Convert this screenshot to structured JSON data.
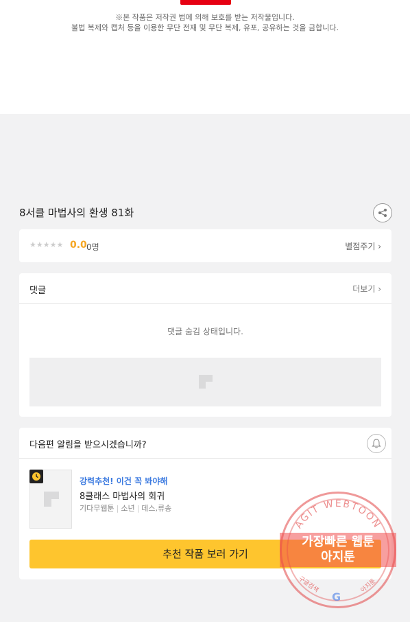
{
  "copyright": {
    "line1": "※본 작품은 저작권 법에 의해 보호를 받는 저작물입니다.",
    "line2": "불법 복제와 캡처 등을 이용한 무단 전재 및 무단 복제, 유포, 공유하는 것을 금합니다."
  },
  "episode": {
    "title": "8서클 마법사의 환생 81화"
  },
  "rating": {
    "stars": "★★★★★",
    "score": "0.0",
    "count": "0명",
    "rate_link": "별점주기 ›"
  },
  "comments": {
    "header": "댓글",
    "more": "더보기 ›",
    "hidden_message": "댓글 숨김 상태입니다."
  },
  "next_episode": {
    "question": "다음편 알림을 받으시겠습니까?",
    "recommend_tag": "강력추천! 이건 꼭 봐야해",
    "recommend_title": "8클래스 마법사의 회귀",
    "meta": [
      "기다무웹툰",
      "소년",
      "데스,류송"
    ],
    "button_label": "추천 작품 보러 가기"
  },
  "watermark": {
    "arc_text": "AGIT WEBTOON",
    "band_line1": "가장빠른 웹툰",
    "band_line2": "아지툰",
    "bottom_left": "구글검색",
    "bottom_right": "아지툰",
    "google_letter": "G"
  },
  "colors": {
    "accent_yellow": "#fec52e",
    "score_orange": "#f5a623",
    "tag_blue": "#3d7be0",
    "logo_red": "#e60012"
  },
  "icons": {
    "share": "share-icon",
    "bell": "bell-icon",
    "clock": "clock-icon",
    "image_placeholder": "image-placeholder-icon"
  }
}
